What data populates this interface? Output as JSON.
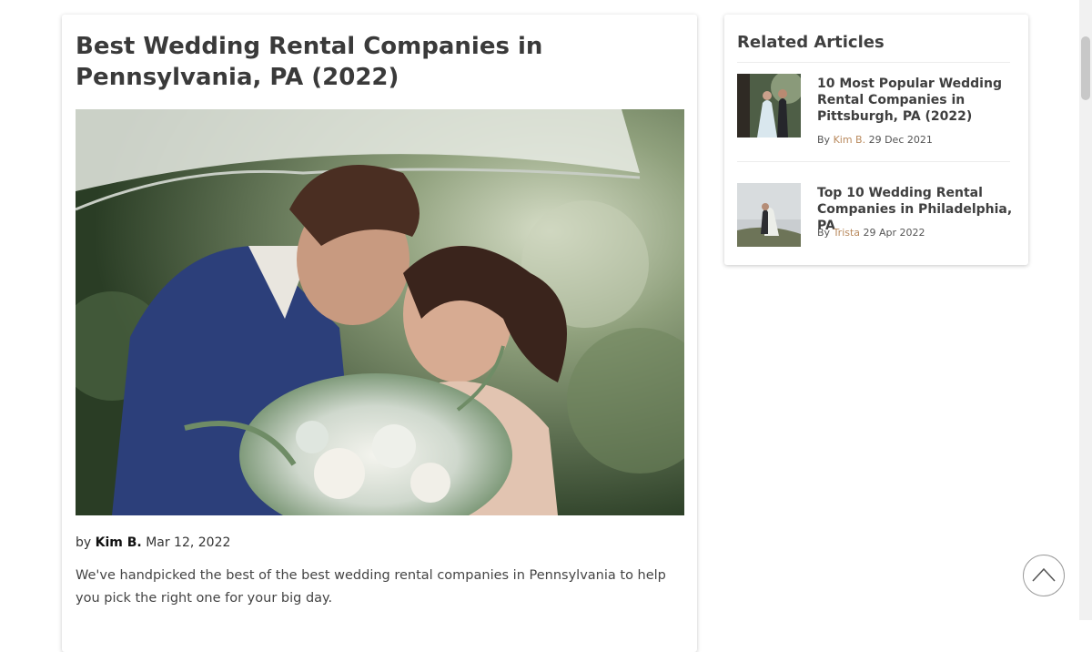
{
  "article": {
    "title": "Best Wedding Rental Companies in Pennsylvania, PA (2022)",
    "byline_prefix": "by",
    "author": "Kim B.",
    "date": "Mar 12, 2022",
    "excerpt": "We've handpicked the best of the best wedding rental companies in Pennsylvania to help you pick the right one for your big day.",
    "hero_image": "couple-kissing-under-umbrella-photo"
  },
  "sidebar": {
    "title": "Related Articles",
    "items": [
      {
        "title": "10 Most Popular Wedding Rental Companies in Pittsburgh, PA (2022)",
        "by": "By",
        "author": "Kim B.",
        "date": "29 Dec 2021",
        "thumbnail": "bride-groom-in-park-photo"
      },
      {
        "title": "Top 10 Wedding Rental Companies in Philadelphia, PA",
        "by": "By",
        "author": "Trista",
        "date": "29 Apr 2022",
        "thumbnail": "couple-on-hill-photo"
      }
    ]
  },
  "controls": {
    "back_to_top_icon": "chevron-up-icon"
  },
  "colors": {
    "author_link": "#b98a5e",
    "title": "#3a3a3a"
  }
}
